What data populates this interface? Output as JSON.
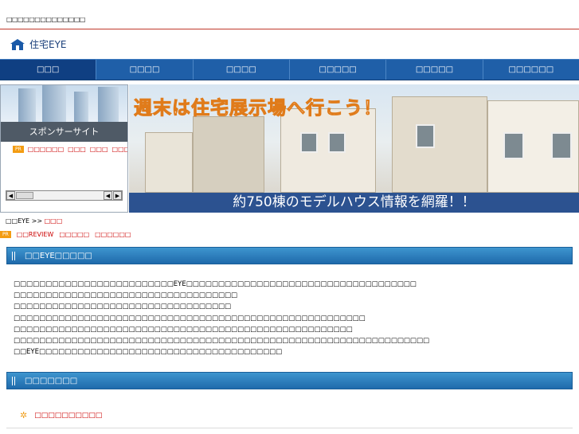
{
  "topbar": {
    "tagline": "□□□□□□□□□□□□□□"
  },
  "logo": {
    "text": "住宅EYE"
  },
  "nav": [
    {
      "label": "□□□"
    },
    {
      "label": "□□□□"
    },
    {
      "label": "□□□□"
    },
    {
      "label": "□□□□□"
    },
    {
      "label": "□□□□□"
    },
    {
      "label": "□□□□□□"
    }
  ],
  "sponsor": {
    "title": "スポンサーサイト",
    "pr_badge": "PR",
    "links": [
      "□□□□□□",
      "□□□",
      "□□□",
      "□□□□□"
    ]
  },
  "banner": {
    "headline": "週末は住宅展示場へ行こう！",
    "tagline": "約750棟のモデルハウス情報を網羅！！"
  },
  "breadcrumb": {
    "home": "□□EYE",
    "separator": ">>",
    "current": "□□□"
  },
  "prline": {
    "badge": "PR",
    "links": [
      "□□REVIEW",
      "□□□□□",
      "□□□□□□"
    ]
  },
  "section_about": {
    "title": "□□EYE□□□□□",
    "lines": [
      "□□□□□□□□□□□□□□□□□□□□□□□□□EYE□□□□□□□□□□□□□□□□□□□□□□□□□□□□□□□□□□□□",
      "□□□□□□□□□□□□□□□□□□□□□□□□□□□□□□□□□□□",
      "□□□□□□□□□□□□□□□□□□□□□□□□□□□□□□□□□□",
      "□□□□□□□□□□□□□□□□□□□□□□□□□□□□□□□□□□□□□□□□□□□□□□□□□□□□□□□",
      "□□□□□□□□□□□□□□□□□□□□□□□□□□□□□□□□□□□□□□□□□□□□□□□□□□□□□",
      "□□□□□□□□□□□□□□□□□□□□□□□□□□□□□□□□□□□□□□□□□□□□□□□□□□□□□□□□□□□□□□□□□",
      "□□EYE□□□□□□□□□□□□□□□□□□□□□□□□□□□□□□□□□□□□□□"
    ]
  },
  "section_sub": {
    "title": "□□□□□□□",
    "item": "□□□□□□□□□□"
  },
  "colors": {
    "nav": "#1f5fa8",
    "section": "#2a7abd",
    "link": "#cc0000",
    "accent_rule": "#c0392b"
  }
}
